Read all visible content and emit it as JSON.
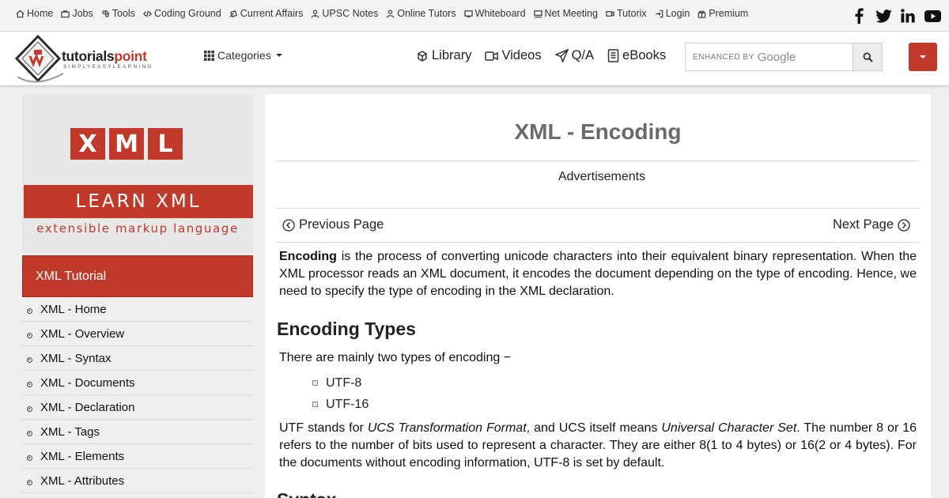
{
  "topnav": [
    {
      "label": "Home",
      "icon": "home-icon"
    },
    {
      "label": "Jobs",
      "icon": "briefcase-icon"
    },
    {
      "label": "Tools",
      "icon": "tools-icon"
    },
    {
      "label": "Coding Ground",
      "icon": "code-icon"
    },
    {
      "label": "Current Affairs",
      "icon": "news-icon"
    },
    {
      "label": "UPSC Notes",
      "icon": "user-tie-icon"
    },
    {
      "label": "Online Tutors",
      "icon": "user-icon"
    },
    {
      "label": "Whiteboard",
      "icon": "whiteboard-icon"
    },
    {
      "label": "Net Meeting",
      "icon": "meeting-icon"
    },
    {
      "label": "Tutorix",
      "icon": "video-icon"
    },
    {
      "label": "Login",
      "icon": "login-icon"
    },
    {
      "label": "Premium",
      "icon": "gift-icon"
    }
  ],
  "social": [
    "facebook-icon",
    "twitter-icon",
    "linkedin-icon",
    "youtube-icon"
  ],
  "header": {
    "logo_main": "tutorials",
    "logo_accent": "point",
    "logo_tagline": "SIMPLYEASYLEARNING",
    "categories_label": "Categories",
    "nav": [
      {
        "label": "Library",
        "icon": "library-icon"
      },
      {
        "label": "Videos",
        "icon": "video-camera-icon"
      },
      {
        "label": "Q/A",
        "icon": "paper-plane-icon"
      },
      {
        "label": "eBooks",
        "icon": "book-icon"
      }
    ],
    "search_placeholder_prefix": "ENHANCED BY",
    "search_placeholder_brand": "Google"
  },
  "banner": {
    "letters": [
      "X",
      "M",
      "L"
    ],
    "strip_text": "LEARN XML",
    "subtitle": "extensible markup language"
  },
  "sidebar": {
    "title": "XML Tutorial",
    "items": [
      "XML - Home",
      "XML - Overview",
      "XML - Syntax",
      "XML - Documents",
      "XML - Declaration",
      "XML - Tags",
      "XML - Elements",
      "XML - Attributes"
    ]
  },
  "content": {
    "title": "XML - Encoding",
    "ads_label": "Advertisements",
    "prev_label": "Previous Page",
    "next_label": "Next Page",
    "intro_bold": "Encoding",
    "intro_rest": " is the process of converting unicode characters into their equivalent binary representation. When the XML processor reads an XML document, it encodes the document depending on the type of encoding. Hence, we need to specify the type of encoding in the XML declaration.",
    "section_heading": "Encoding Types",
    "types_intro": "There are mainly two types of encoding −",
    "types": [
      "UTF-8",
      "UTF-16"
    ],
    "utf_p1": "UTF stands for ",
    "utf_em1": "UCS Transformation Format",
    "utf_p2": ", and UCS itself means ",
    "utf_em2": "Universal Character Set",
    "utf_p3": ". The number 8 or 16 refers to the number of bits used to represent a character. They are either 8(1 to 4 bytes) or 16(2 or 4 bytes). For the documents without encoding information, UTF-8 is set by default.",
    "next_heading": "Syntax"
  },
  "colors": {
    "brand_red": "#c0392b",
    "title_gray": "#6a6a6a"
  }
}
